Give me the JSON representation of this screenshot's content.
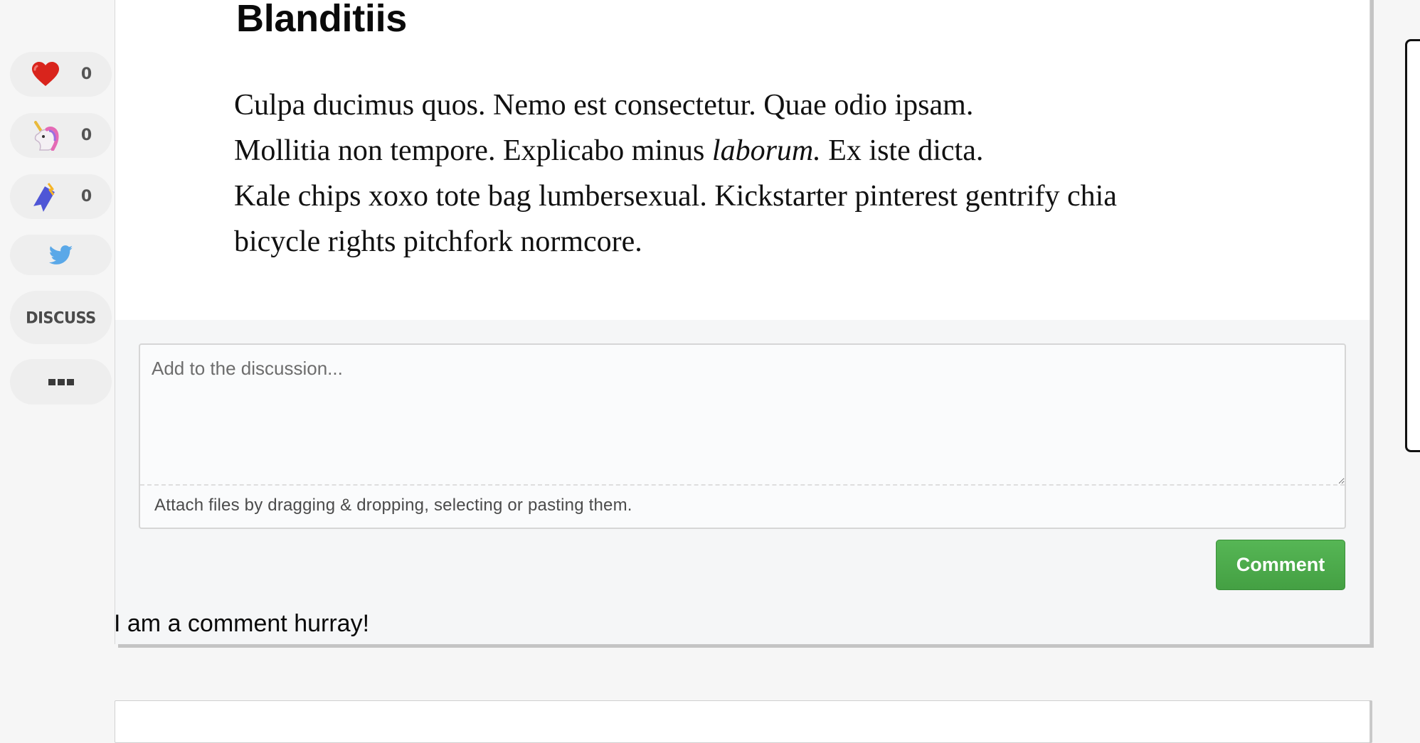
{
  "reactions": {
    "heart": {
      "icon": "heart-icon",
      "count": "0"
    },
    "unicorn": {
      "icon": "unicorn-icon",
      "count": "0"
    },
    "reading_list": {
      "icon": "bookmark-icon",
      "count": "0"
    },
    "twitter": {
      "icon": "twitter-icon"
    },
    "discuss_label": "DISCUSS",
    "more": {
      "icon": "more-dots-icon"
    }
  },
  "article": {
    "heading": "Blanditiis",
    "lines": [
      "Culpa ducimus quos. Nemo est consectetur. Quae odio ipsam.",
      "Mollitia non tempore. Explicabo minus ",
      "laborum.",
      " Ex iste dicta.",
      "Kale chips xoxo tote bag lumbersexual. Kickstarter pinterest gentrify chia",
      "bicycle rights pitchfork normcore."
    ]
  },
  "discussion": {
    "placeholder": "Add to the discussion...",
    "attach_hint": "Attach files by dragging & dropping, selecting or pasting them.",
    "submit_label": "Comment",
    "comment_text": "I am a comment hurray!"
  },
  "colors": {
    "heart": "#d9241c",
    "twitter": "#5aa8e8",
    "comment_button": "#4caf50"
  }
}
